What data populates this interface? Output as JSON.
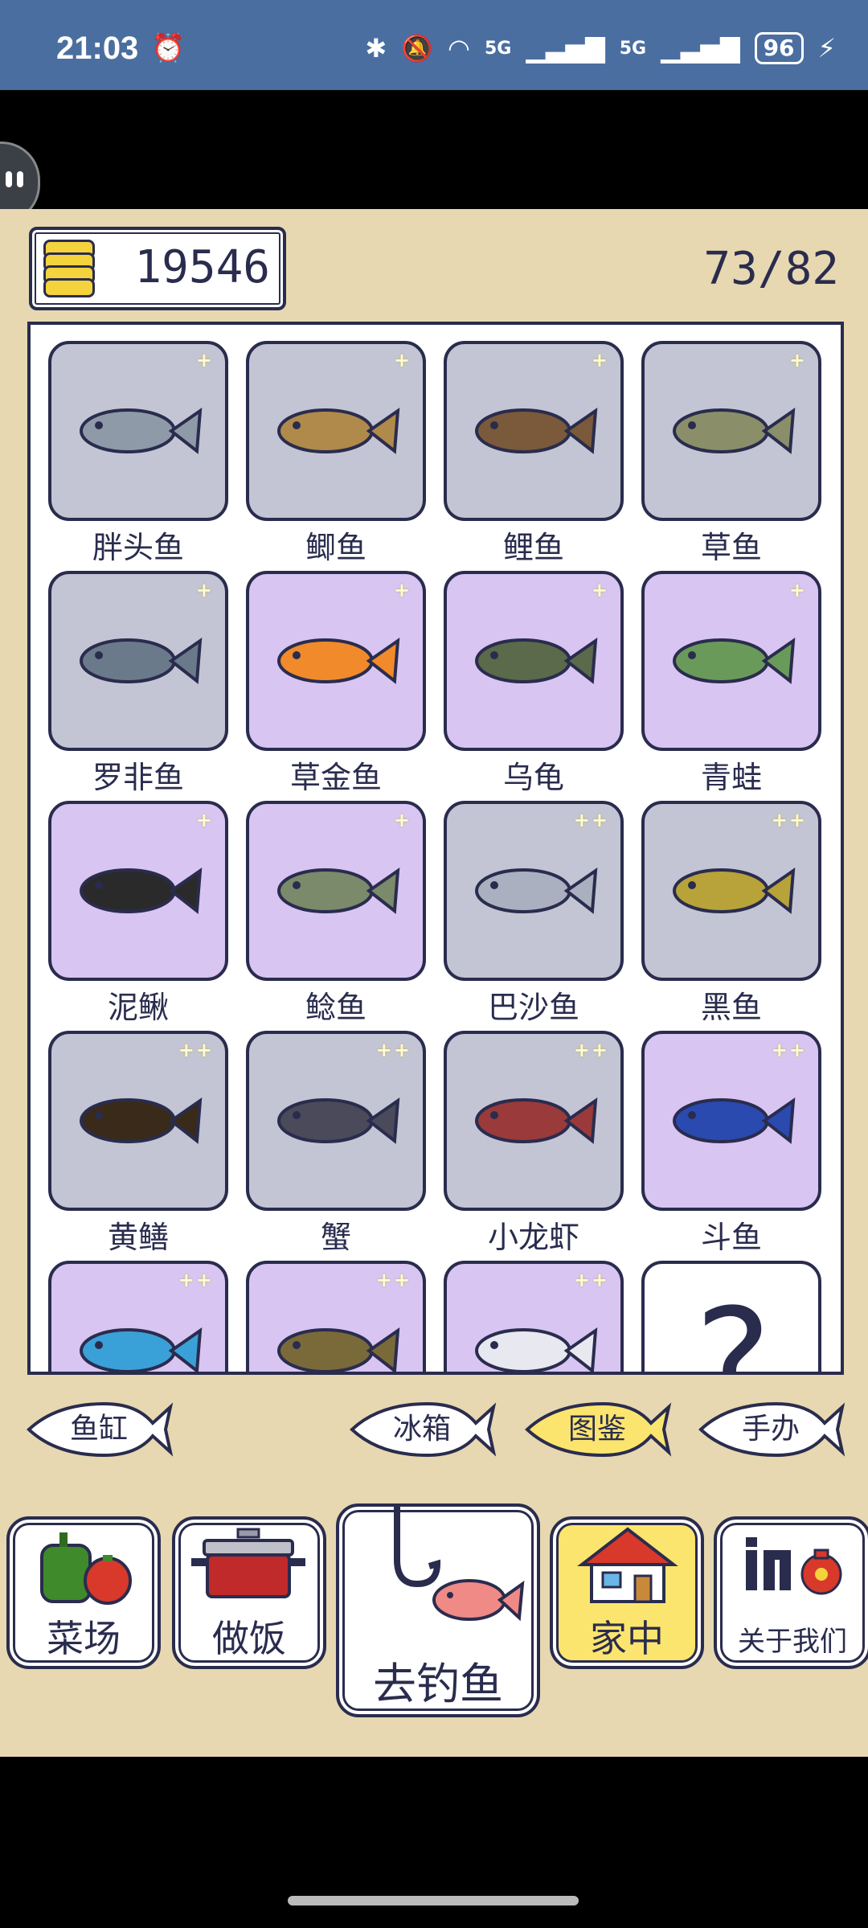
{
  "status_bar": {
    "time": "21:03",
    "network": "5G",
    "network2": "5G",
    "battery": "96"
  },
  "header": {
    "coins": "19546",
    "progress": "73/82"
  },
  "fish": [
    {
      "name": "胖头鱼",
      "rarity": "+",
      "bg": "gray"
    },
    {
      "name": "鲫鱼",
      "rarity": "+",
      "bg": "gray"
    },
    {
      "name": "鲤鱼",
      "rarity": "+",
      "bg": "gray"
    },
    {
      "name": "草鱼",
      "rarity": "+",
      "bg": "gray"
    },
    {
      "name": "罗非鱼",
      "rarity": "+",
      "bg": "gray"
    },
    {
      "name": "草金鱼",
      "rarity": "+",
      "bg": "purple"
    },
    {
      "name": "乌龟",
      "rarity": "+",
      "bg": "purple"
    },
    {
      "name": "青蛙",
      "rarity": "+",
      "bg": "purple"
    },
    {
      "name": "泥鳅",
      "rarity": "+",
      "bg": "purple"
    },
    {
      "name": "鲶鱼",
      "rarity": "+",
      "bg": "purple"
    },
    {
      "name": "巴沙鱼",
      "rarity": "++",
      "bg": "gray"
    },
    {
      "name": "黑鱼",
      "rarity": "++",
      "bg": "gray"
    },
    {
      "name": "黄鳝",
      "rarity": "++",
      "bg": "gray"
    },
    {
      "name": "蟹",
      "rarity": "++",
      "bg": "gray"
    },
    {
      "name": "小龙虾",
      "rarity": "++",
      "bg": "gray"
    },
    {
      "name": "斗鱼",
      "rarity": "++",
      "bg": "purple"
    },
    {
      "name": "",
      "rarity": "++",
      "bg": "purple"
    },
    {
      "name": "",
      "rarity": "++",
      "bg": "purple"
    },
    {
      "name": "",
      "rarity": "++",
      "bg": "purple"
    },
    {
      "name": "",
      "rarity": "",
      "bg": "white",
      "unknown": "?"
    }
  ],
  "tabs": [
    {
      "label": "鱼缸",
      "selected": false
    },
    {
      "label": "冰箱",
      "selected": false
    },
    {
      "label": "图鉴",
      "selected": true
    },
    {
      "label": "手办",
      "selected": false
    }
  ],
  "nav": [
    {
      "label": "菜场",
      "selected": false
    },
    {
      "label": "做饭",
      "selected": false
    },
    {
      "label": "去钓鱼",
      "selected": false
    },
    {
      "label": "家中",
      "selected": true
    },
    {
      "label": "关于我们",
      "selected": false
    }
  ],
  "colors": {
    "ink": "#2a2c4e",
    "bg": "#e7d8b1",
    "card_gray": "#c3c5d4",
    "card_purple": "#d8c5f2",
    "selected": "#fbe56e",
    "statusbar": "#4a6ea0"
  }
}
